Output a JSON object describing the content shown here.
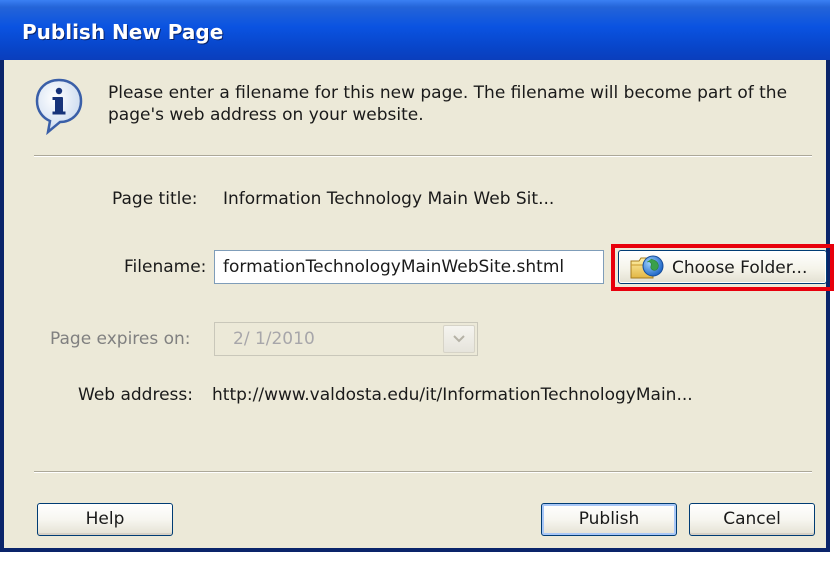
{
  "window": {
    "title": "Publish New Page"
  },
  "info": {
    "icon": "info-icon",
    "message": "Please enter a filename for this new page. The filename will become part of the page's web address on your website."
  },
  "form": {
    "page_title_label": "Page title:",
    "page_title_value": "Information Technology Main Web Sit...",
    "filename_label": "Filename:",
    "filename_value": "formationTechnologyMainWebSite.shtml",
    "choose_folder_label": "Choose Folder...",
    "choose_folder_icon": "folder-globe-icon",
    "expires_label": "Page expires on:",
    "expires_value": "2/  1/2010",
    "web_address_label": "Web address:",
    "web_address_value": "http://www.valdosta.edu/it/InformationTechnologyMain..."
  },
  "buttons": {
    "help": "Help",
    "publish": "Publish",
    "cancel": "Cancel"
  },
  "colors": {
    "titlebar": "#0a53e1",
    "dialog_bg": "#ece9d8",
    "highlight": "#e8000c"
  }
}
